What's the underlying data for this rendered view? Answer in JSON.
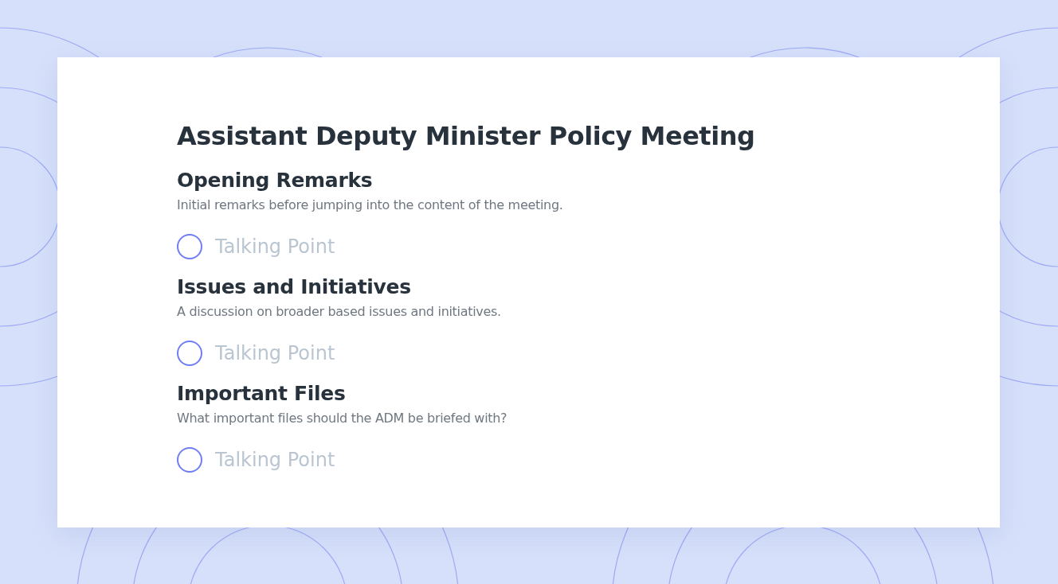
{
  "title": "Assistant Deputy Minister Policy Meeting",
  "sections": [
    {
      "heading": "Opening Remarks",
      "description": "Initial remarks before jumping into the content of the meeting.",
      "items": [
        {
          "placeholder": "Talking Point",
          "checked": false
        }
      ]
    },
    {
      "heading": "Issues and Initiatives",
      "description": "A discussion on broader based issues and initiatives.",
      "items": [
        {
          "placeholder": "Talking Point",
          "checked": false
        }
      ]
    },
    {
      "heading": "Important Files",
      "description": "What important files should the ADM be briefed with?",
      "items": [
        {
          "placeholder": "Talking Point",
          "checked": false
        }
      ]
    }
  ]
}
